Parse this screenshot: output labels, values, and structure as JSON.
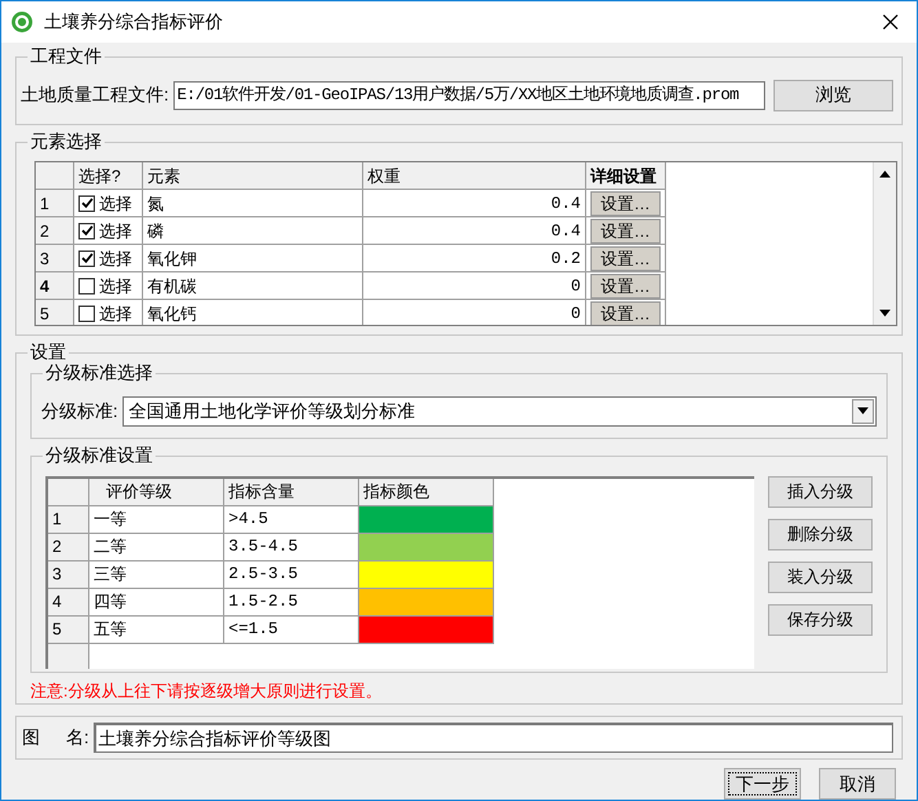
{
  "window": {
    "title": "土壤养分综合指标评价"
  },
  "project_file": {
    "group_title": "工程文件",
    "label": "土地质量工程文件:",
    "value": "E:/01软件开发/01-GeoIPAS/13用户数据/5万/XX地区土地环境地质调查.prom",
    "browse_button": "浏览"
  },
  "element_selection": {
    "group_title": "元素选择",
    "columns": [
      "选择?",
      "元素",
      "权重",
      "详细设置"
    ],
    "rows": [
      {
        "number": "1",
        "checked": true,
        "check_label": "选择",
        "element": "氮",
        "weight": "0.4",
        "button": "设置…",
        "selected": false
      },
      {
        "number": "2",
        "checked": true,
        "check_label": "选择",
        "element": "磷",
        "weight": "0.4",
        "button": "设置…",
        "selected": false
      },
      {
        "number": "3",
        "checked": true,
        "check_label": "选择",
        "element": "氧化钾",
        "weight": "0.2",
        "button": "设置…",
        "selected": false
      },
      {
        "number": "4",
        "checked": false,
        "check_label": "选择",
        "element": "有机碳",
        "weight": "0",
        "button": "设置…",
        "selected": true
      },
      {
        "number": "5",
        "checked": false,
        "check_label": "选择",
        "element": "氧化钙",
        "weight": "0",
        "button": "设置…",
        "selected": false
      }
    ]
  },
  "settings": {
    "group_title": "设置",
    "standard_selection": {
      "group_title": "分级标准选择",
      "label": "分级标准:",
      "value": "全国通用土地化学评价等级划分标准"
    },
    "standard_settings": {
      "group_title": "分级标准设置",
      "columns": [
        "评价等级",
        "指标含量",
        "指标颜色"
      ],
      "rows": [
        {
          "number": "1",
          "grade": "一等",
          "content": ">4.5",
          "color": "#00b050"
        },
        {
          "number": "2",
          "grade": "二等",
          "content": "3.5-4.5",
          "color": "#92d050"
        },
        {
          "number": "3",
          "grade": "三等",
          "content": "2.5-3.5",
          "color": "#ffff00"
        },
        {
          "number": "4",
          "grade": "四等",
          "content": "1.5-2.5",
          "color": "#ffc000"
        },
        {
          "number": "5",
          "grade": "五等",
          "content": "<=1.5",
          "color": "#ff0000"
        }
      ],
      "buttons": [
        "插入分级",
        "删除分级",
        "装入分级",
        "保存分级"
      ]
    },
    "note": "注意:分级从上往下请按逐级增大原则进行设置。"
  },
  "map_name": {
    "label_1": "图",
    "label_2": "名:",
    "value": "土壤养分综合指标评价等级图"
  },
  "buttons": [
    "下一步",
    "取消"
  ]
}
